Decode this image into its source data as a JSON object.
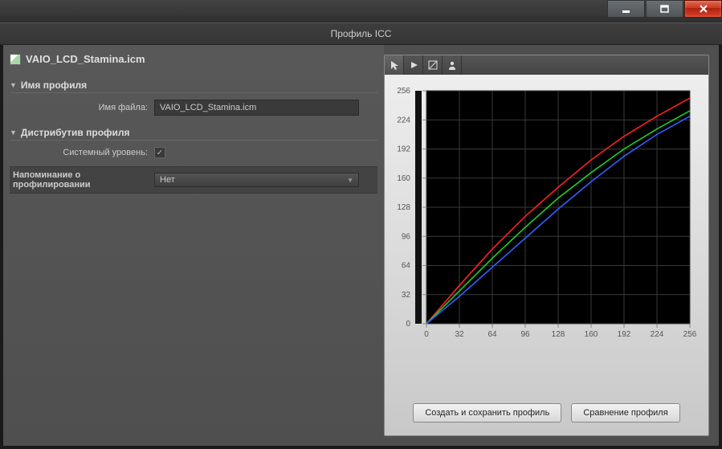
{
  "window": {
    "subtitle": "Профиль ICC"
  },
  "file": {
    "name": "VAIO_LCD_Stamina.icm"
  },
  "sections": {
    "profile_name": "Имя профиля",
    "file_name_label": "Имя файла:",
    "file_name_value": "VAIO_LCD_Stamina.icm",
    "distribution": "Дистрибутив профиля",
    "system_level_label": "Системный уровень:",
    "system_level_checked": true,
    "reminder_label": "Напоминание о профилировании",
    "reminder_value": "Нет"
  },
  "buttons": {
    "create_save": "Создать и сохранить профиль",
    "compare": "Сравнение профиля"
  },
  "chart_data": {
    "type": "line",
    "xlabel": "",
    "ylabel": "",
    "xlim": [
      0,
      256
    ],
    "ylim": [
      0,
      256
    ],
    "x_ticks": [
      0,
      32,
      64,
      96,
      128,
      160,
      192,
      224,
      256
    ],
    "y_ticks": [
      0,
      32,
      64,
      96,
      128,
      160,
      192,
      224,
      256
    ],
    "series": [
      {
        "name": "red",
        "color": "#ff2020",
        "x": [
          0,
          32,
          64,
          96,
          128,
          160,
          192,
          224,
          256
        ],
        "values": [
          0,
          42,
          82,
          118,
          150,
          180,
          206,
          228,
          248
        ]
      },
      {
        "name": "green",
        "color": "#20d020",
        "x": [
          0,
          32,
          64,
          96,
          128,
          160,
          192,
          224,
          256
        ],
        "values": [
          0,
          36,
          72,
          106,
          138,
          166,
          192,
          214,
          234
        ]
      },
      {
        "name": "blue",
        "color": "#3060ff",
        "x": [
          0,
          32,
          64,
          96,
          128,
          160,
          192,
          224,
          256
        ],
        "values": [
          0,
          30,
          62,
          94,
          126,
          156,
          184,
          208,
          228
        ]
      }
    ]
  }
}
